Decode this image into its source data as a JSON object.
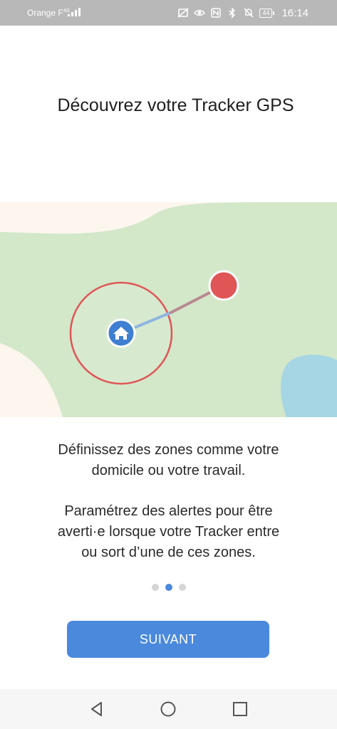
{
  "status_bar": {
    "carrier": "Orange F",
    "network": "4G",
    "battery": "44",
    "time": "16:14",
    "icons": [
      "signal-icon",
      "screen-off-icon",
      "eye-comfort-icon",
      "nfc-icon",
      "bluetooth-icon",
      "silent-bell-icon",
      "battery-icon"
    ]
  },
  "onboarding": {
    "title": "Découvrez votre Tracker GPS",
    "illustration_icons": [
      "home-icon",
      "tracker-location-icon"
    ],
    "description_line1": "Définissez des zones comme votre",
    "description_line2": "domicile ou votre travail.",
    "alert_line1": "Paramétrez des alertes pour être",
    "alert_line2": "averti·e lorsque votre Tracker entre",
    "alert_line3": "ou sort d’une de ces zones.",
    "pager": {
      "total": 3,
      "active_index": 1
    },
    "next_button_label": "SUIVANT"
  },
  "colors": {
    "accent": "#4a89dc",
    "geofence_red": "#e05555",
    "map_green": "#d3e7c9",
    "map_water": "#a6d6e3",
    "map_sand": "#fcf6ee"
  },
  "navigation_bar": {
    "buttons": [
      "back-icon",
      "home-circle-icon",
      "recent-apps-icon"
    ]
  }
}
